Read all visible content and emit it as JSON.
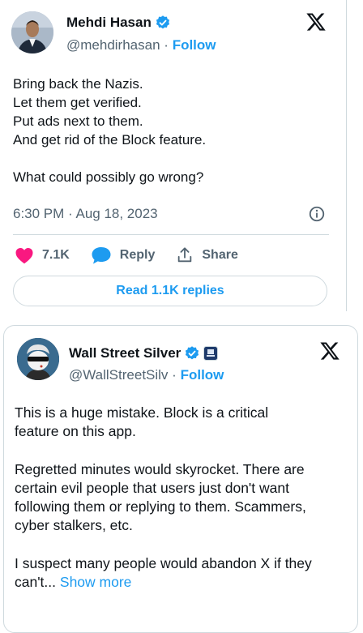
{
  "tweet1": {
    "author_name": "Mehdi Hasan",
    "handle": "@mehdirhasan",
    "separator": "·",
    "follow_label": "Follow",
    "lines": [
      "Bring back the Nazis.",
      "Let them get verified.",
      "Put ads next to them.",
      "And get rid of the Block feature.",
      "",
      "What could possibly go wrong?"
    ],
    "timestamp": "6:30 PM · Aug 18, 2023",
    "likes": "7.1K",
    "reply_label": "Reply",
    "share_label": "Share",
    "read_replies_label": "Read 1.1K replies",
    "verified_color": "#1d9bf0",
    "like_color": "#f91880",
    "logo_icon": "x-logo-icon"
  },
  "tweet2": {
    "author_name": "Wall Street Silver",
    "handle": "@WallStreetSilv",
    "separator": "·",
    "follow_label": "Follow",
    "lines": [
      "This is a huge mistake. Block is a critical",
      "feature on this app.",
      "",
      "Regretted minutes would skyrocket. There are",
      "certain evil people that users just don't want",
      "following them or replying to them. Scammers,",
      "cyber stalkers, etc.",
      "",
      "I suspect many people would abandon X if they"
    ],
    "last_line": "can't...",
    "show_more_label": "Show more",
    "verified_color": "#1d9bf0",
    "logo_icon": "x-logo-icon"
  },
  "colors": {
    "link": "#1d9bf0",
    "secondary_text": "#536471",
    "border": "#cfd9de"
  }
}
